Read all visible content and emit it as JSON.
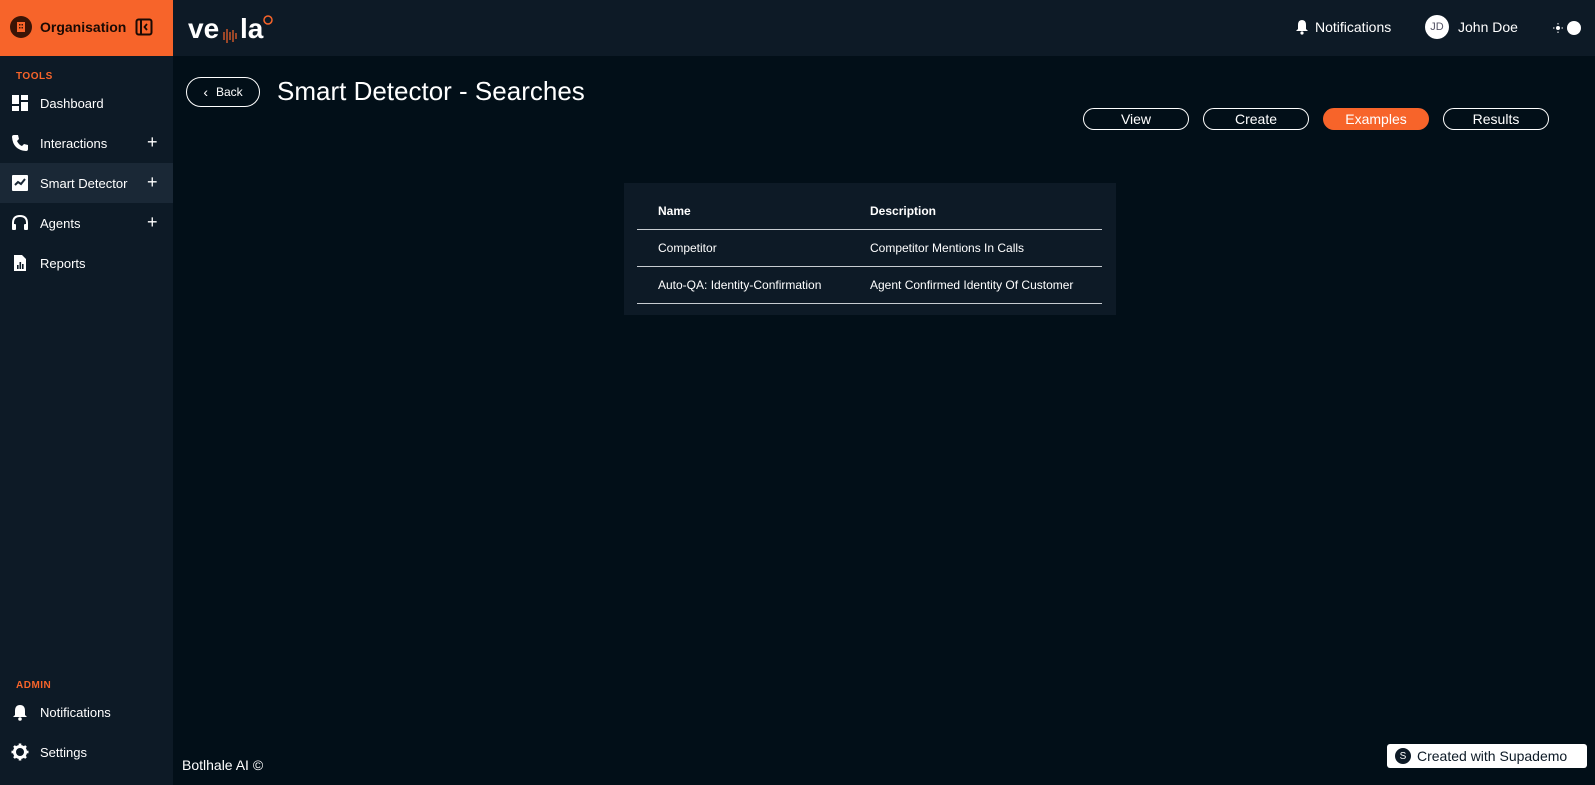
{
  "sidebar": {
    "org_label": "Organisation",
    "tools_label": "TOOLS",
    "admin_label": "ADMIN",
    "tools": [
      {
        "label": "Dashboard",
        "icon": "dashboard-icon"
      },
      {
        "label": "Interactions",
        "icon": "phone-icon"
      },
      {
        "label": "Smart Detector",
        "icon": "chart-icon"
      },
      {
        "label": "Agents",
        "icon": "headset-icon"
      },
      {
        "label": "Reports",
        "icon": "report-icon"
      }
    ],
    "admin": [
      {
        "label": "Notifications",
        "icon": "bell-icon"
      },
      {
        "label": "Settings",
        "icon": "gear-icon"
      }
    ],
    "footer": "Botlhale AI ©"
  },
  "header": {
    "logo_text": "vela",
    "notifications_label": "Notifications",
    "avatar_initials": "JD",
    "user_name": "John Doe"
  },
  "page": {
    "back_label": "Back",
    "title": "Smart Detector - Searches",
    "tabs": [
      {
        "label": "View",
        "active": false
      },
      {
        "label": "Create",
        "active": false
      },
      {
        "label": "Examples",
        "active": true
      },
      {
        "label": "Results",
        "active": false
      }
    ]
  },
  "table": {
    "columns": [
      "Name",
      "Description"
    ],
    "rows": [
      [
        "Competitor",
        "Competitor Mentions In Calls"
      ],
      [
        "Auto-QA: Identity-Confirmation",
        "Agent Confirmed Identity Of Customer"
      ]
    ]
  },
  "badge": {
    "label": "Created with Supademo"
  },
  "colors": {
    "accent": "#f7642a",
    "background": "#020f18",
    "panel": "#0d1a26"
  }
}
